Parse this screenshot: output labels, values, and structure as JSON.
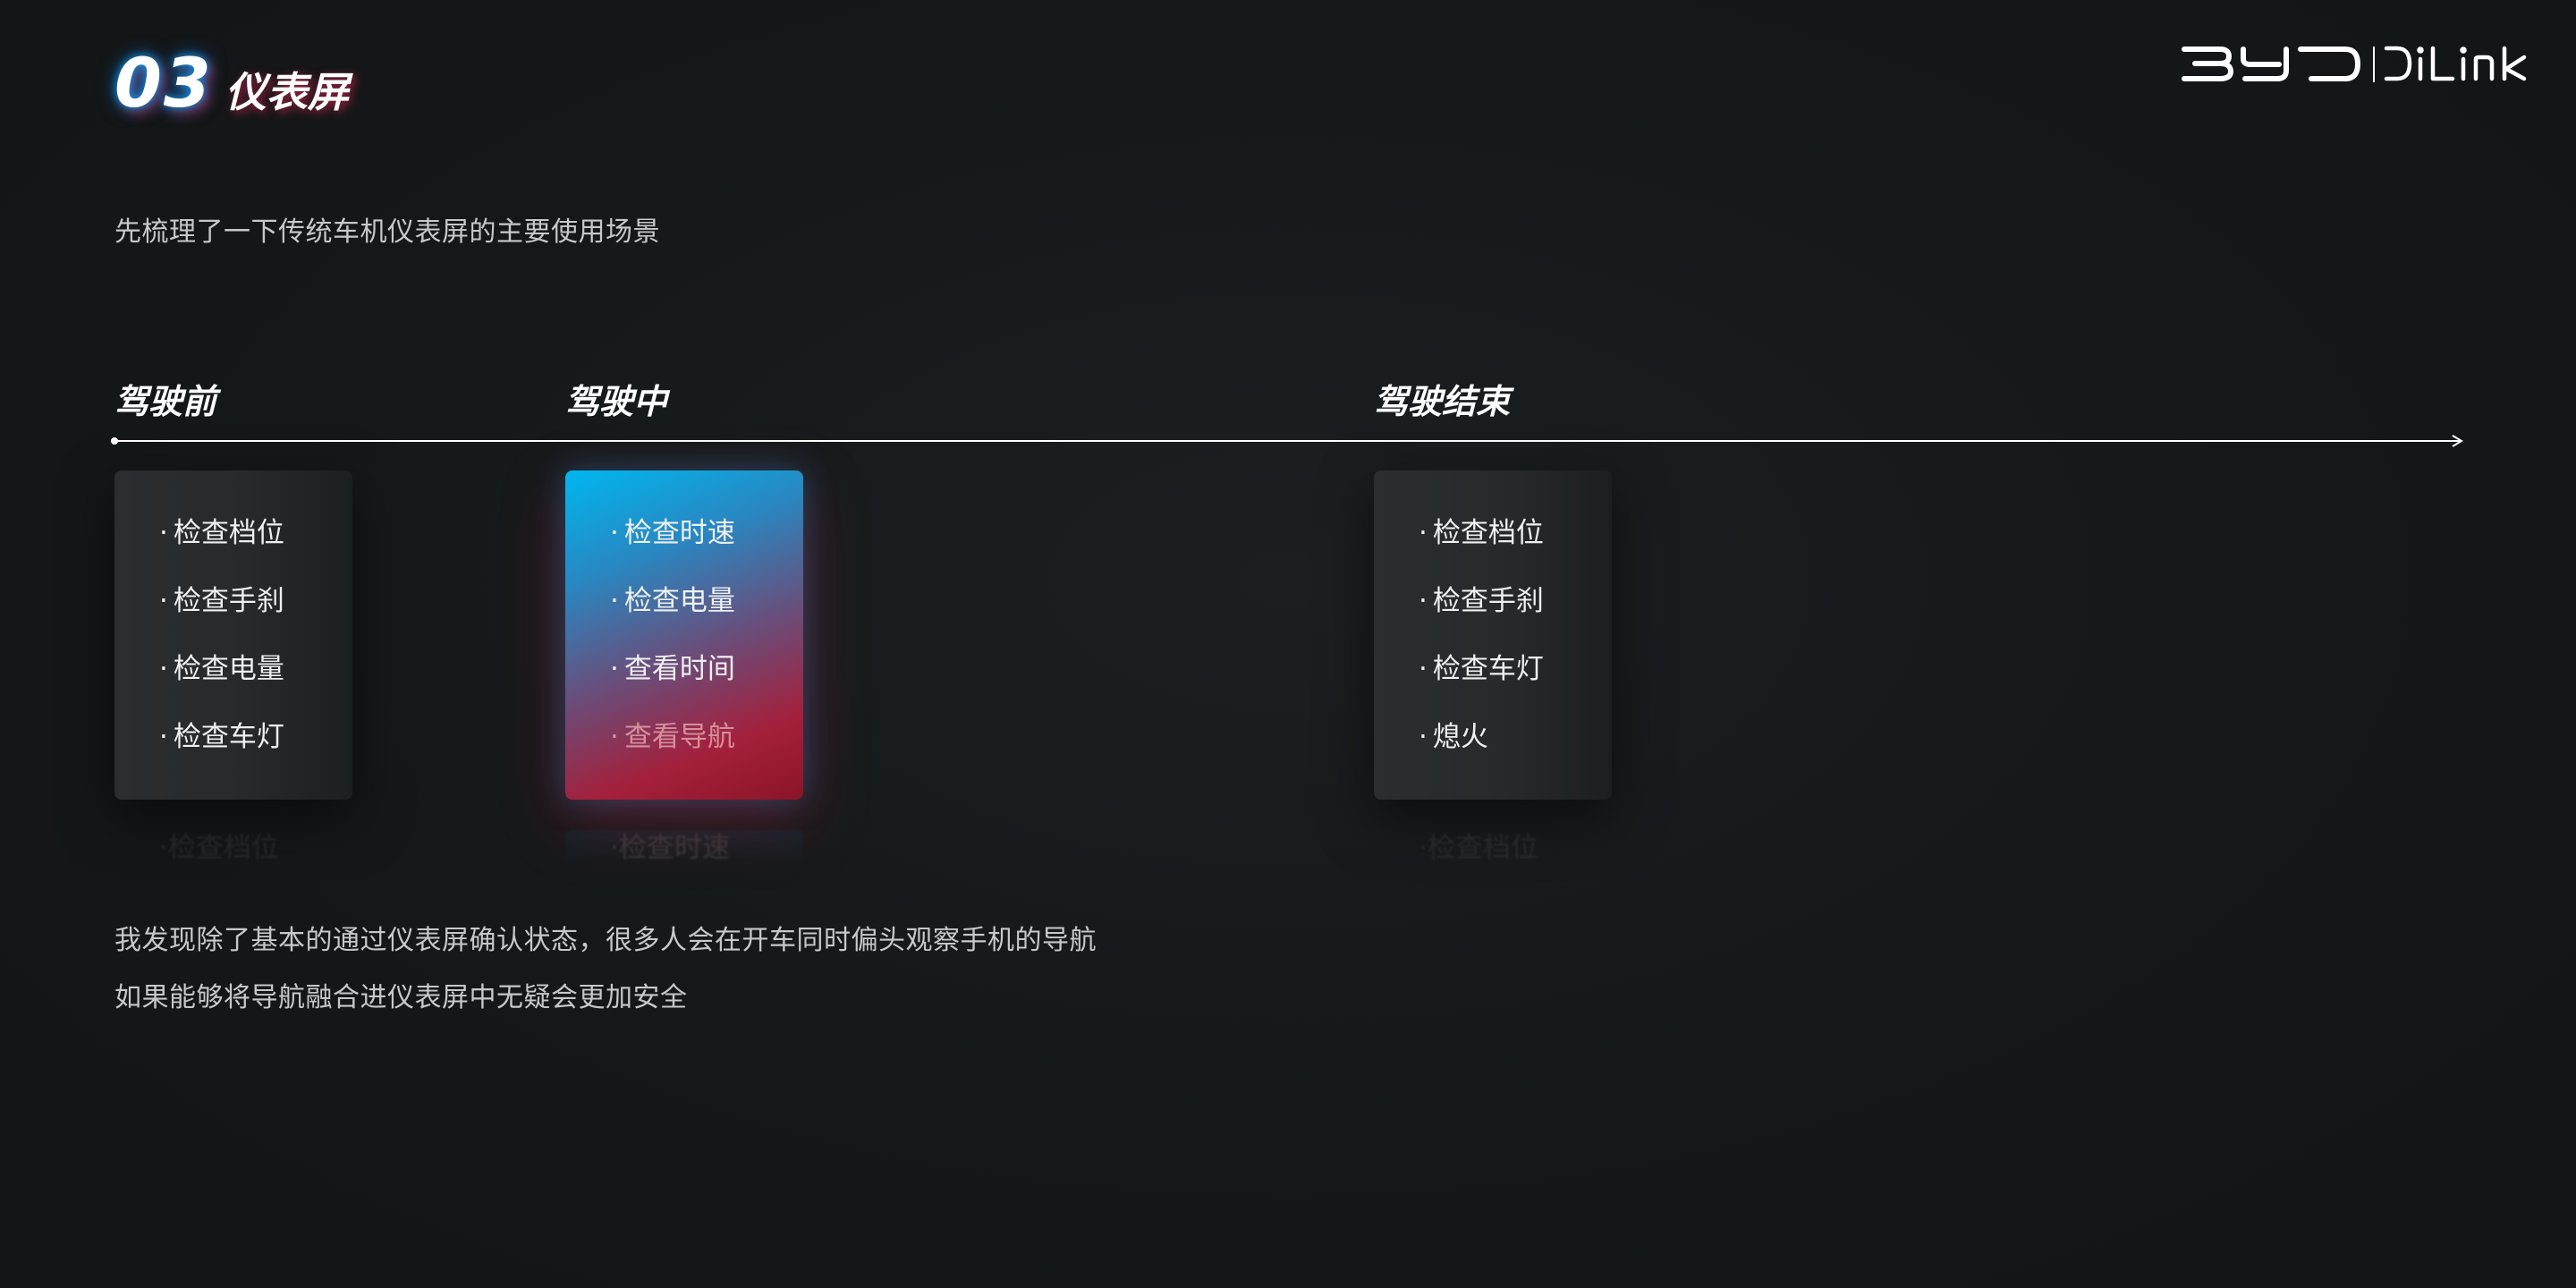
{
  "header": {
    "section_number": "03",
    "section_title": "仪表屏",
    "brand": "BYD | DiLink"
  },
  "intro": "先梳理了一下传统车机仪表屏的主要使用场景",
  "timeline": {
    "phases": [
      {
        "label": "驾驶前",
        "items": [
          "检查档位",
          "检查手刹",
          "检查电量",
          "检查车灯"
        ],
        "highlighted": false
      },
      {
        "label": "驾驶中",
        "items": [
          "检查时速",
          "检查电量",
          "查看时间",
          "查看导航"
        ],
        "highlighted": true
      },
      {
        "label": "驾驶结束",
        "items": [
          "检查档位",
          "检查手刹",
          "检查车灯",
          "熄火"
        ],
        "highlighted": false
      }
    ]
  },
  "conclusion": [
    "我发现除了基本的通过仪表屏确认状态，很多人会在开车同时偏头观察手机的导航",
    "如果能够将导航融合进仪表屏中无疑会更加安全"
  ],
  "colors": {
    "background": "#151819",
    "card_dark": "#2b2e30",
    "accent_blue": "#00b7f0",
    "accent_red": "#a4203c",
    "text": "#ffffff",
    "body_text": "#c6c9cb"
  }
}
